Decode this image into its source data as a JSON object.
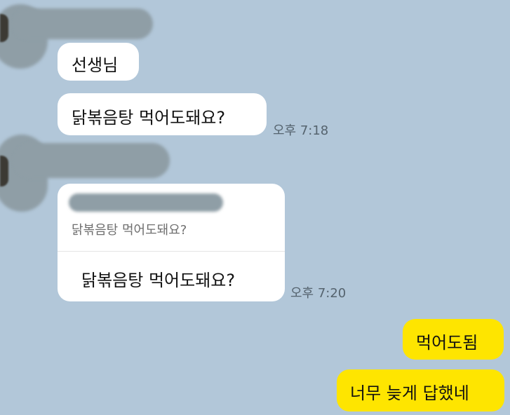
{
  "messages": [
    {
      "id": "m1",
      "text": "선생님"
    },
    {
      "id": "m2",
      "text": "닭볶음탕 먹어도돼요?",
      "time": "오후 7:18"
    },
    {
      "id": "m3",
      "reply_quote": "닭볶음탕 먹어도돼요?",
      "text": "닭볶음탕 먹어도돼요?",
      "time": "오후 7:20"
    }
  ],
  "my_messages": [
    {
      "id": "my1",
      "text": "먹어도됨"
    },
    {
      "id": "my2",
      "text": "너무 늦게 답했네"
    }
  ],
  "colors": {
    "background": "#b2c7d9",
    "incoming_bubble": "#ffffff",
    "outgoing_bubble": "#fee500",
    "timestamp": "#55636e"
  }
}
